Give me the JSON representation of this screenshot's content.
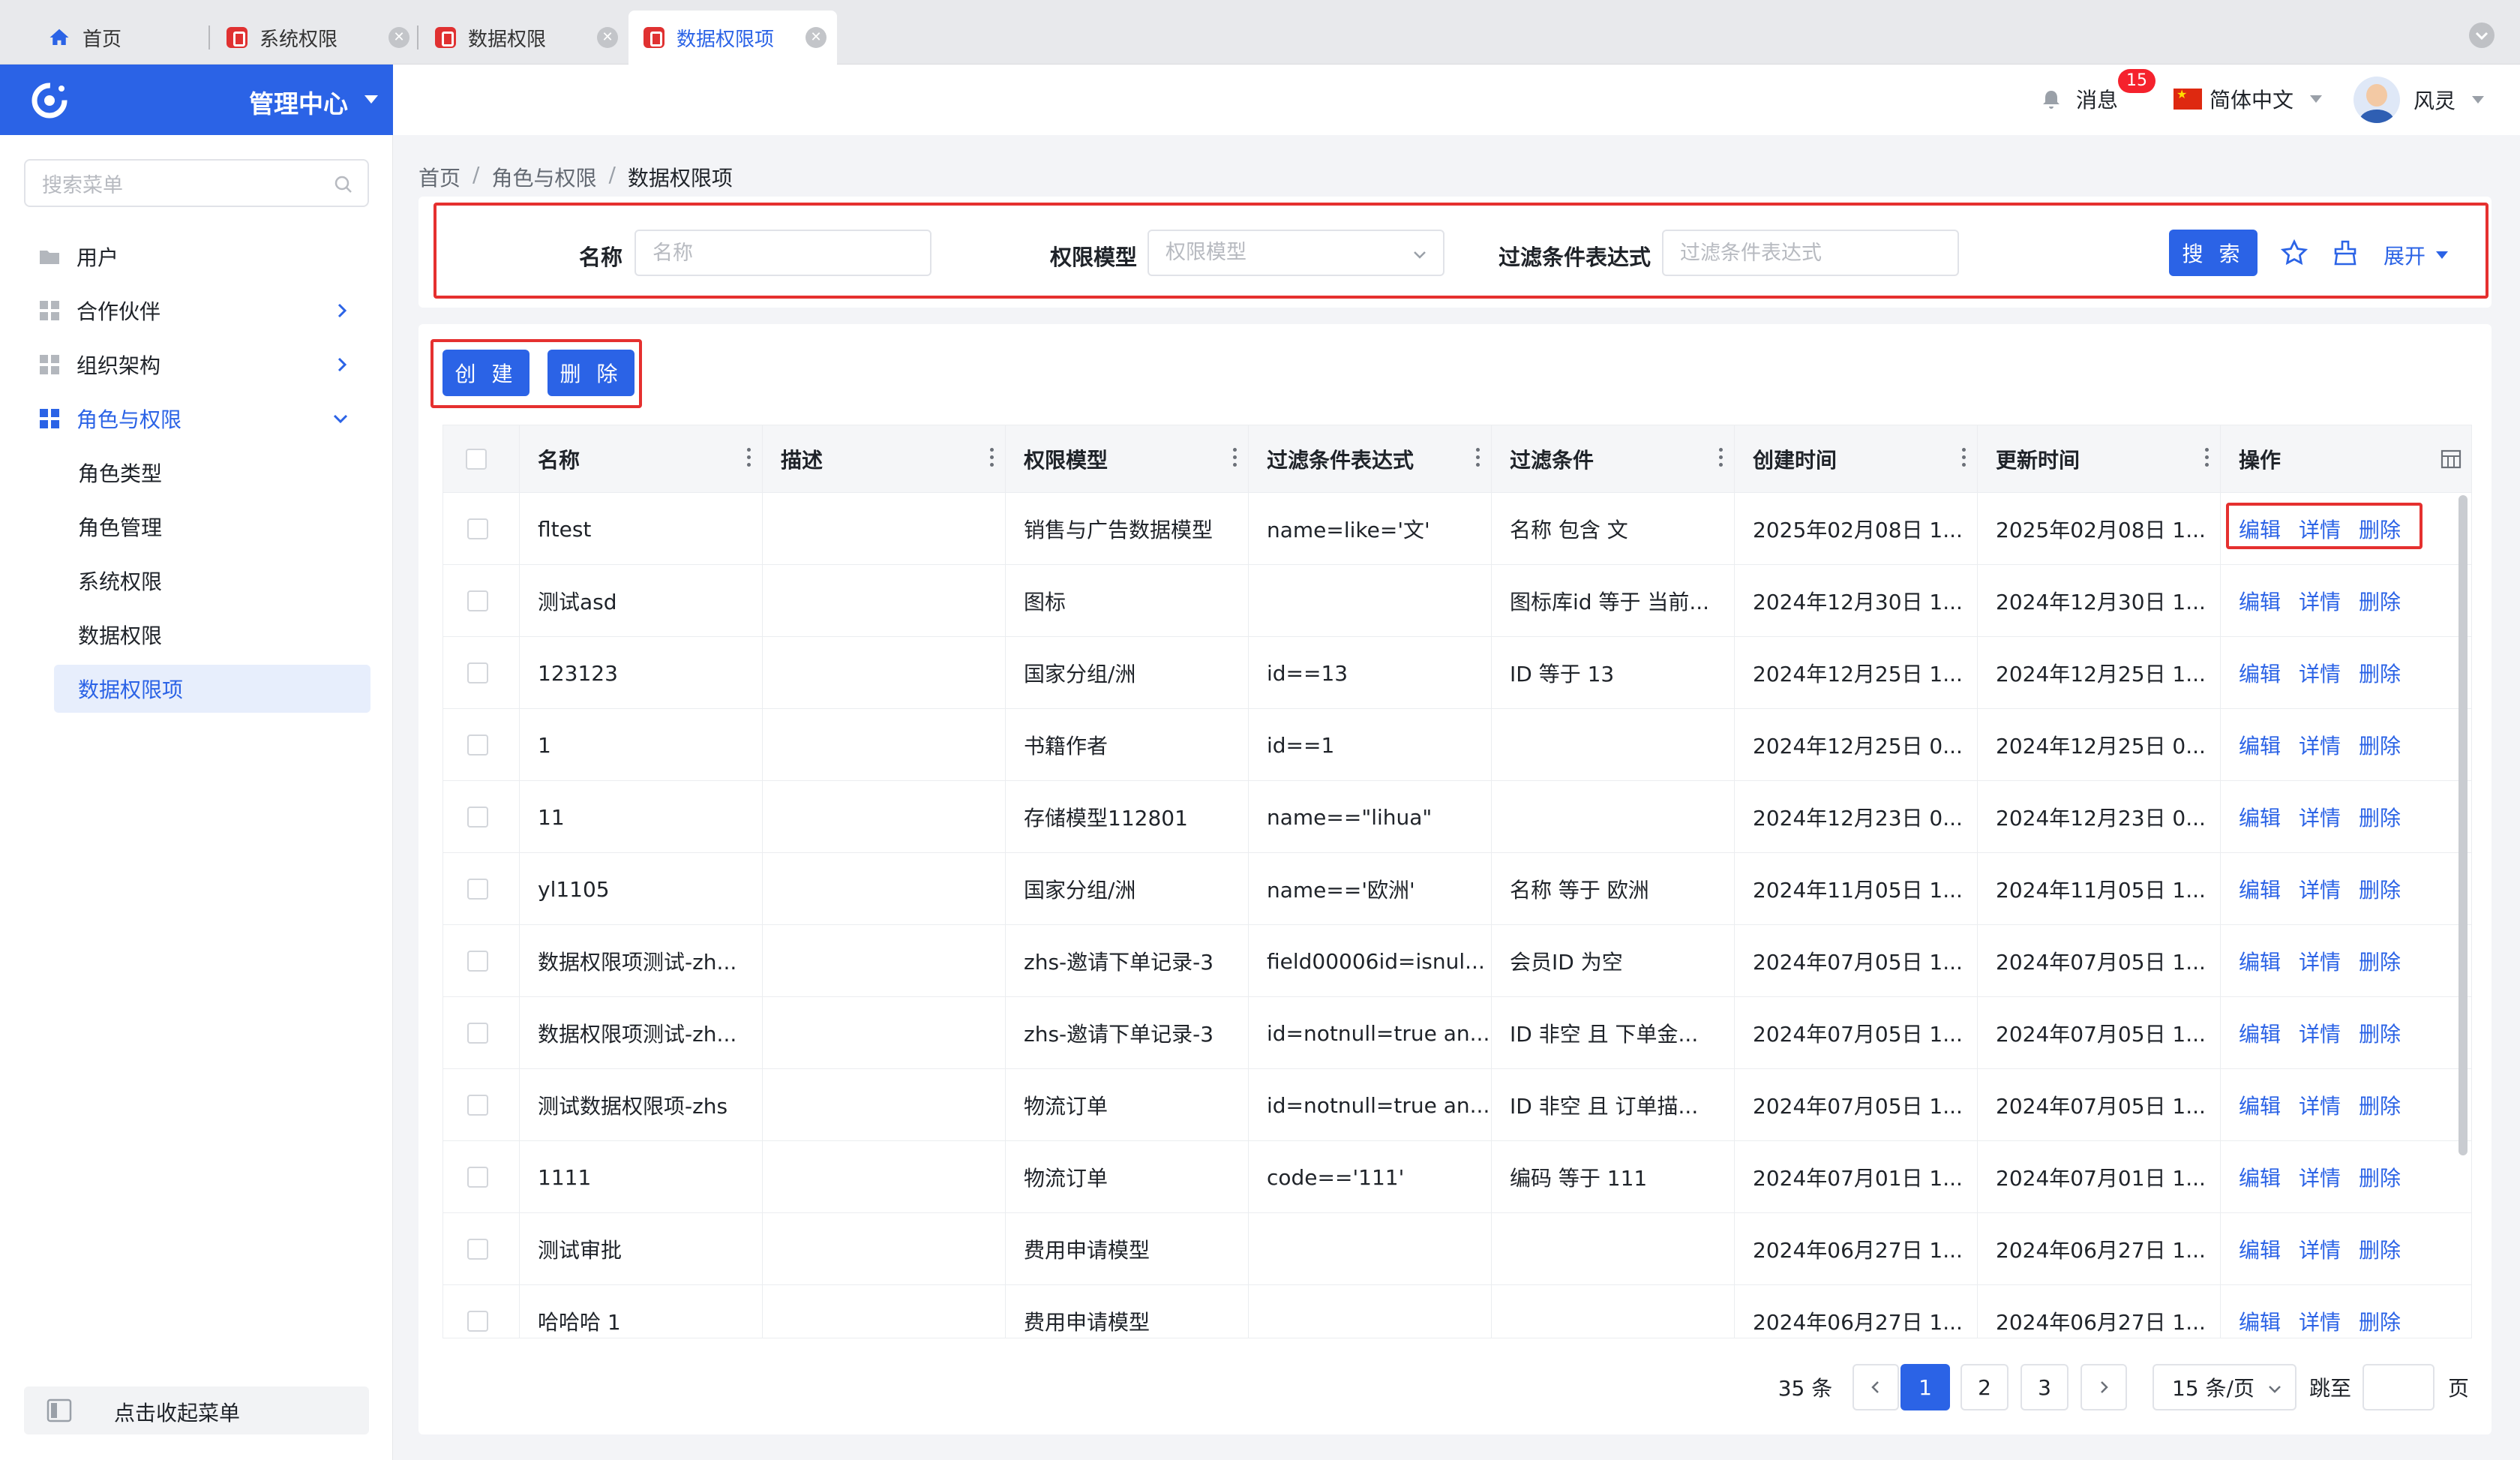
{
  "tabs": [
    {
      "label": "首页",
      "active": false,
      "closable": false
    },
    {
      "label": "系统权限",
      "active": false,
      "closable": true
    },
    {
      "label": "数据权限",
      "active": false,
      "closable": true
    },
    {
      "label": "数据权限项",
      "active": true,
      "closable": true
    }
  ],
  "brand": {
    "title": "管理中心"
  },
  "menu_search": {
    "placeholder": "搜索菜单"
  },
  "menu": [
    {
      "label": "用户",
      "icon": "folder-icon"
    },
    {
      "label": "合作伙伴",
      "icon": "grid-icon"
    },
    {
      "label": "组织架构",
      "icon": "grid-icon"
    },
    {
      "label": "角色与权限",
      "icon": "grid-icon",
      "open": true
    }
  ],
  "submenu": [
    {
      "label": "角色类型"
    },
    {
      "label": "角色管理"
    },
    {
      "label": "系统权限"
    },
    {
      "label": "数据权限"
    },
    {
      "label": "数据权限项",
      "active": true
    }
  ],
  "collapse_menu": "点击收起菜单",
  "header": {
    "messages": "消息",
    "badge": "15",
    "language": "简体中文",
    "user": "风灵"
  },
  "breadcrumb": {
    "home": "首页",
    "parent": "角色与权限",
    "current": "数据权限项"
  },
  "filter": {
    "name_label": "名称",
    "name_placeholder": "名称",
    "model_label": "权限模型",
    "model_placeholder": "权限模型",
    "expr_label": "过滤条件表达式",
    "expr_placeholder": "过滤条件表达式",
    "search": "搜 索",
    "expand": "展开"
  },
  "actions": {
    "create": "创 建",
    "delete": "删 除"
  },
  "columns": [
    "名称",
    "描述",
    "权限模型",
    "过滤条件表达式",
    "过滤条件",
    "创建时间",
    "更新时间",
    "操作"
  ],
  "row_actions": {
    "edit": "编辑",
    "detail": "详情",
    "delete": "删除"
  },
  "rows": [
    {
      "name": "fltest",
      "desc": "",
      "model": "销售与广告数据模型",
      "expr": "name=like='文'",
      "cond": "名称 包含 文",
      "created": "2025年02月08日 1...",
      "updated": "2025年02月08日 1..."
    },
    {
      "name": "测试asd",
      "desc": "",
      "model": "图标",
      "expr": "",
      "cond": "图标库id 等于 当前...",
      "created": "2024年12月30日 1...",
      "updated": "2024年12月30日 1..."
    },
    {
      "name": "123123",
      "desc": "",
      "model": "国家分组/洲",
      "expr": "id==13",
      "cond": "ID 等于 13",
      "created": "2024年12月25日 1...",
      "updated": "2024年12月25日 1..."
    },
    {
      "name": "1",
      "desc": "",
      "model": "书籍作者",
      "expr": "id==1",
      "cond": "",
      "created": "2024年12月25日 0...",
      "updated": "2024年12月25日 0..."
    },
    {
      "name": "11",
      "desc": "",
      "model": "存储模型112801",
      "expr": "name==\"lihua\"",
      "cond": "",
      "created": "2024年12月23日 0...",
      "updated": "2024年12月23日 0..."
    },
    {
      "name": "yl1105",
      "desc": "",
      "model": "国家分组/洲",
      "expr": "name=='欧洲'",
      "cond": "名称 等于 欧洲",
      "created": "2024年11月05日 1...",
      "updated": "2024年11月05日 1..."
    },
    {
      "name": "数据权限项测试-zh...",
      "desc": "",
      "model": "zhs-邀请下单记录-3",
      "expr": "field00006id=isnul...",
      "cond": "会员ID 为空",
      "created": "2024年07月05日 1...",
      "updated": "2024年07月05日 1..."
    },
    {
      "name": "数据权限项测试-zh...",
      "desc": "",
      "model": "zhs-邀请下单记录-3",
      "expr": "id=notnull=true an...",
      "cond": "ID 非空 且 下单金...",
      "created": "2024年07月05日 1...",
      "updated": "2024年07月05日 1..."
    },
    {
      "name": "测试数据权限项-zhs",
      "desc": "",
      "model": "物流订单",
      "expr": "id=notnull=true an...",
      "cond": "ID 非空 且 订单描...",
      "created": "2024年07月05日 1...",
      "updated": "2024年07月05日 1..."
    },
    {
      "name": "1111",
      "desc": "",
      "model": "物流订单",
      "expr": "code=='111'",
      "cond": "编码 等于 111",
      "created": "2024年07月01日 1...",
      "updated": "2024年07月01日 1..."
    },
    {
      "name": "测试审批",
      "desc": "",
      "model": "费用申请模型",
      "expr": "",
      "cond": "",
      "created": "2024年06月27日 1...",
      "updated": "2024年06月27日 1..."
    },
    {
      "name": "哈哈哈 1",
      "desc": "",
      "model": "费用申请模型",
      "expr": "",
      "cond": "",
      "created": "2024年06月27日 1...",
      "updated": "2024年06月27日 1..."
    }
  ],
  "pagination": {
    "total": "35 条",
    "pages": [
      "1",
      "2",
      "3"
    ],
    "current": "1",
    "page_size": "15 条/页",
    "jump_label": "跳至",
    "page_unit": "页"
  },
  "colors": {
    "primary": "#2b63e6",
    "highlight": "#e5302f",
    "badge": "#f5222d"
  }
}
